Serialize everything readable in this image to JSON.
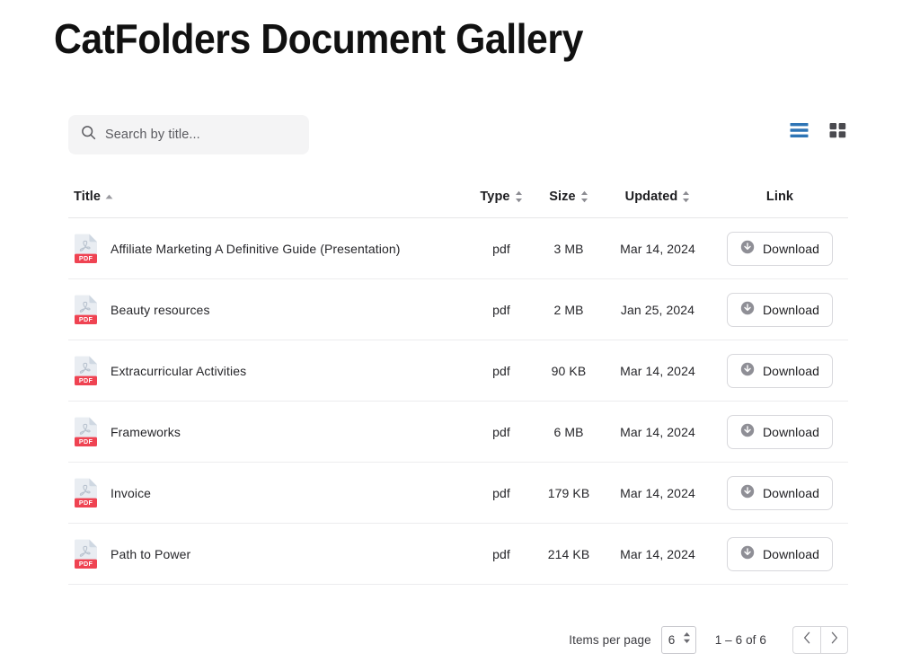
{
  "header": {
    "title": "CatFolders Document Gallery"
  },
  "toolbar": {
    "search": {
      "placeholder": "Search by title...",
      "value": "",
      "icon": "search-icon"
    },
    "views": [
      {
        "name": "list-view",
        "icon": "list-view-icon",
        "active": true,
        "color": "#2d74b5"
      },
      {
        "name": "grid-view",
        "icon": "grid-view-icon",
        "active": false,
        "color": "#4a4a4f"
      }
    ]
  },
  "table": {
    "columns": [
      {
        "key": "title",
        "label": "Title",
        "sort": "asc"
      },
      {
        "key": "type",
        "label": "Type",
        "sort": "none"
      },
      {
        "key": "size",
        "label": "Size",
        "sort": "none"
      },
      {
        "key": "updated",
        "label": "Updated",
        "sort": "none"
      },
      {
        "key": "link",
        "label": "Link",
        "sort": null
      }
    ],
    "rows": [
      {
        "icon": "pdf-file-icon",
        "icon_label": "PDF",
        "title": "Affiliate Marketing A Definitive Guide (Presentation)",
        "type": "pdf",
        "size": "3 MB",
        "updated": "Mar 14, 2024",
        "link_label": "Download"
      },
      {
        "icon": "pdf-file-icon",
        "icon_label": "PDF",
        "title": "Beauty resources",
        "type": "pdf",
        "size": "2 MB",
        "updated": "Jan 25, 2024",
        "link_label": "Download"
      },
      {
        "icon": "pdf-file-icon",
        "icon_label": "PDF",
        "title": "Extracurricular Activities",
        "type": "pdf",
        "size": "90 KB",
        "updated": "Mar 14, 2024",
        "link_label": "Download"
      },
      {
        "icon": "pdf-file-icon",
        "icon_label": "PDF",
        "title": "Frameworks",
        "type": "pdf",
        "size": "6 MB",
        "updated": "Mar 14, 2024",
        "link_label": "Download"
      },
      {
        "icon": "pdf-file-icon",
        "icon_label": "PDF",
        "title": "Invoice",
        "type": "pdf",
        "size": "179 KB",
        "updated": "Mar 14, 2024",
        "link_label": "Download"
      },
      {
        "icon": "pdf-file-icon",
        "icon_label": "PDF",
        "title": "Path to Power",
        "type": "pdf",
        "size": "214 KB",
        "updated": "Mar 14, 2024",
        "link_label": "Download"
      }
    ]
  },
  "pagination": {
    "items_per_page_label": "Items per page",
    "items_per_page_value": "6",
    "range_label": "1 – 6 of 6",
    "prev_icon": "chevron-left-icon",
    "next_icon": "chevron-right-icon"
  },
  "colors": {
    "accent_blue": "#2d74b5",
    "pdf_red": "#ef4352",
    "text_primary": "#1d1d20",
    "border": "#e6e6e8",
    "search_bg": "#f4f4f5"
  }
}
